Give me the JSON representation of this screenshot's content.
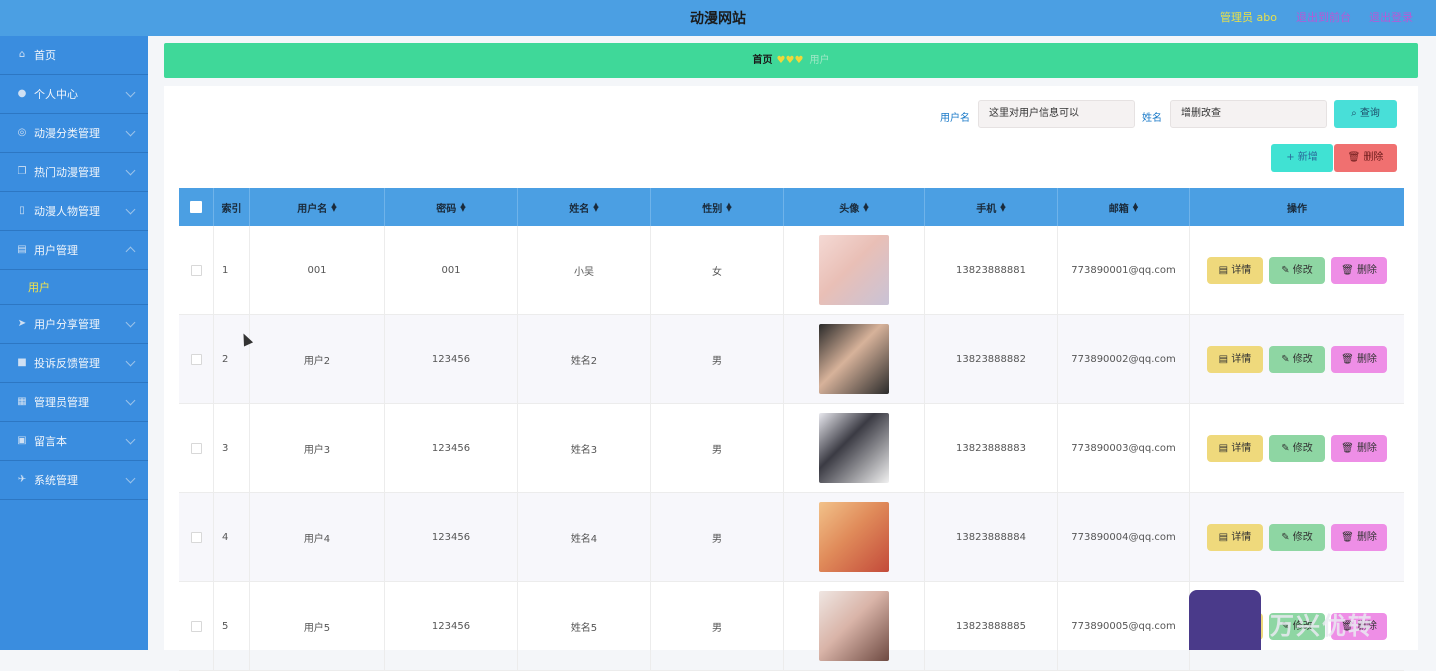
{
  "header": {
    "title": "动漫网站",
    "admin_label": "管理员 abo",
    "exit_front": "退出到前台",
    "logout": "退出登录"
  },
  "sidebar": {
    "items": [
      {
        "label": "首页",
        "icon": "home-icon"
      },
      {
        "label": "个人中心",
        "icon": "person-icon"
      },
      {
        "label": "动漫分类管理",
        "icon": "globe-icon"
      },
      {
        "label": "热门动漫管理",
        "icon": "copy-icon"
      },
      {
        "label": "动漫人物管理",
        "icon": "lock-icon"
      },
      {
        "label": "用户管理",
        "icon": "doc-icon",
        "expanded": true,
        "sub": "用户"
      },
      {
        "label": "用户分享管理",
        "icon": "send-icon"
      },
      {
        "label": "投诉反馈管理",
        "icon": "box-icon"
      },
      {
        "label": "管理员管理",
        "icon": "grid-icon"
      },
      {
        "label": "留言本",
        "icon": "card-icon"
      },
      {
        "label": "系统管理",
        "icon": "plane-icon"
      }
    ]
  },
  "breadcrumb": {
    "home": "首页",
    "hearts": "♥♥♥",
    "current": "用户"
  },
  "search": {
    "username_label": "用户名",
    "username_value": "这里对用户信息可以",
    "name_label": "姓名",
    "name_value": "增删改查",
    "query_label": "查询"
  },
  "actions": {
    "add_label": "新增",
    "delete_label": "删除"
  },
  "table": {
    "headers": [
      "索引",
      "用户名",
      "密码",
      "姓名",
      "性别",
      "头像",
      "手机",
      "邮箱",
      "操作"
    ],
    "rows": [
      {
        "index": "1",
        "username": "001",
        "password": "001",
        "name": "小吴",
        "gender": "女",
        "phone": "13823888881",
        "email": "773890001@qq.com"
      },
      {
        "index": "2",
        "username": "用户2",
        "password": "123456",
        "name": "姓名2",
        "gender": "男",
        "phone": "13823888882",
        "email": "773890002@qq.com"
      },
      {
        "index": "3",
        "username": "用户3",
        "password": "123456",
        "name": "姓名3",
        "gender": "男",
        "phone": "13823888883",
        "email": "773890003@qq.com"
      },
      {
        "index": "4",
        "username": "用户4",
        "password": "123456",
        "name": "姓名4",
        "gender": "男",
        "phone": "13823888884",
        "email": "773890004@qq.com"
      },
      {
        "index": "5",
        "username": "用户5",
        "password": "123456",
        "name": "姓名5",
        "gender": "男",
        "phone": "13823888885",
        "email": "773890005@qq.com"
      }
    ],
    "op_detail": "详情",
    "op_edit": "修改",
    "op_delete": "删除"
  },
  "watermark": {
    "text": "万兴优转"
  }
}
